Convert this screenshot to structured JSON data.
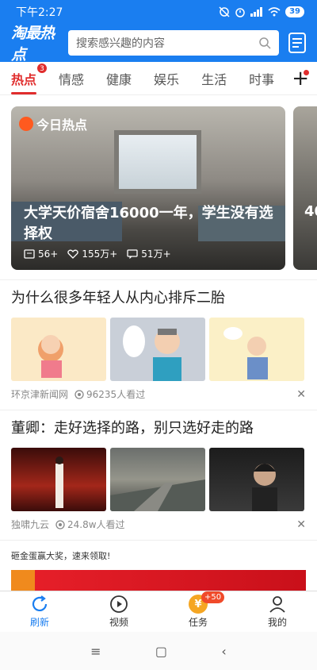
{
  "status": {
    "time": "下午2:27",
    "battery": "39"
  },
  "header": {
    "logo": "淘最热点",
    "search_placeholder": "搜索感兴趣的内容"
  },
  "tabs": [
    {
      "label": "热点",
      "badge": "3"
    },
    {
      "label": "情感"
    },
    {
      "label": "健康"
    },
    {
      "label": "娱乐"
    },
    {
      "label": "生活"
    },
    {
      "label": "时事"
    }
  ],
  "hero": {
    "badge": "今日热点",
    "title": "大学天价宿舍16000一年，学生没有选择权",
    "comments": "56+",
    "likes": "155万+",
    "shares": "51万+",
    "next_title_peek": "40"
  },
  "articles": [
    {
      "title": "为什么很多年轻人从内心排斥二胎",
      "source": "环京津新闻网",
      "views": "96235人看过"
    },
    {
      "title": "董卿：走好选择的路，别只选好走的路",
      "source": "独啸九云",
      "views": "24.8w人看过"
    }
  ],
  "promo": {
    "text": "砸金蛋赢大奖，速来领取!"
  },
  "bottom_nav": [
    {
      "label": "刷新"
    },
    {
      "label": "视频"
    },
    {
      "label": "任务",
      "badge": "+50",
      "coin": "¥"
    },
    {
      "label": "我的"
    }
  ]
}
